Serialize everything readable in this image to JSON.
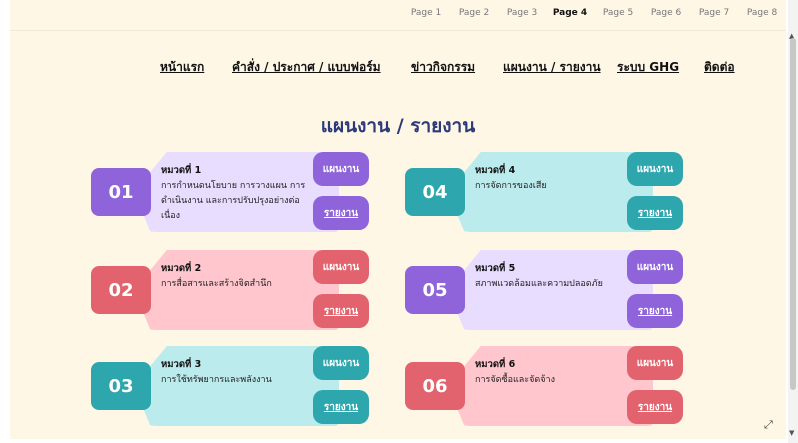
{
  "pager": [
    "Page 1",
    "Page 2",
    "Page 3",
    "Page 4",
    "Page 5",
    "Page 6",
    "Page 7",
    "Page 8"
  ],
  "active_page": "Page 4",
  "nav": [
    "หน้าแรก",
    "คำสั่ง / ประกาศ / แบบฟอร์ม",
    "ข่าวกิจกรรม",
    "แผนงาน / รายงาน",
    "ระบบ GHG",
    "ติดต่อ"
  ],
  "title": "แผนงาน / รายงาน",
  "cards": [
    {
      "num": "01",
      "category": "หมวดที่ 1",
      "desc": "การกำหนดนโยบาย การวางแผน การดำเนินงาน และการปรับปรุงอย่างต่อเนื่อง",
      "plan": "แผนงาน",
      "report": "รายงาน",
      "accent": "#8f63d9",
      "bg": "#e8dcff"
    },
    {
      "num": "02",
      "category": "หมวดที่ 2",
      "desc": "การสื่อสารและสร้างจิตสำนึก",
      "plan": "แผนงาน",
      "report": "รายงาน",
      "accent": "#e2636d",
      "bg": "#ffc6cd"
    },
    {
      "num": "03",
      "category": "หมวดที่ 3",
      "desc": "การใช้ทรัพยากรและพลังงาน",
      "plan": "แผนงาน",
      "report": "รายงาน",
      "accent": "#2ea6ad",
      "bg": "#bcebed"
    },
    {
      "num": "04",
      "category": "หมวดที่ 4",
      "desc": "การจัดการของเสีย",
      "plan": "แผนงาน",
      "report": "รายงาน",
      "accent": "#2ea6ad",
      "bg": "#bcebed"
    },
    {
      "num": "05",
      "category": "หมวดที่ 5",
      "desc": "สภาพแวดล้อมและความปลอดภัย",
      "plan": "แผนงาน",
      "report": "รายงาน",
      "accent": "#8f63d9",
      "bg": "#e8dcff"
    },
    {
      "num": "06",
      "category": "หมวดที่ 6",
      "desc": "การจัดซื้อและจัดจ้าง",
      "plan": "แผนงาน",
      "report": "รายงาน",
      "accent": "#e2636d",
      "bg": "#ffc6cd"
    }
  ]
}
